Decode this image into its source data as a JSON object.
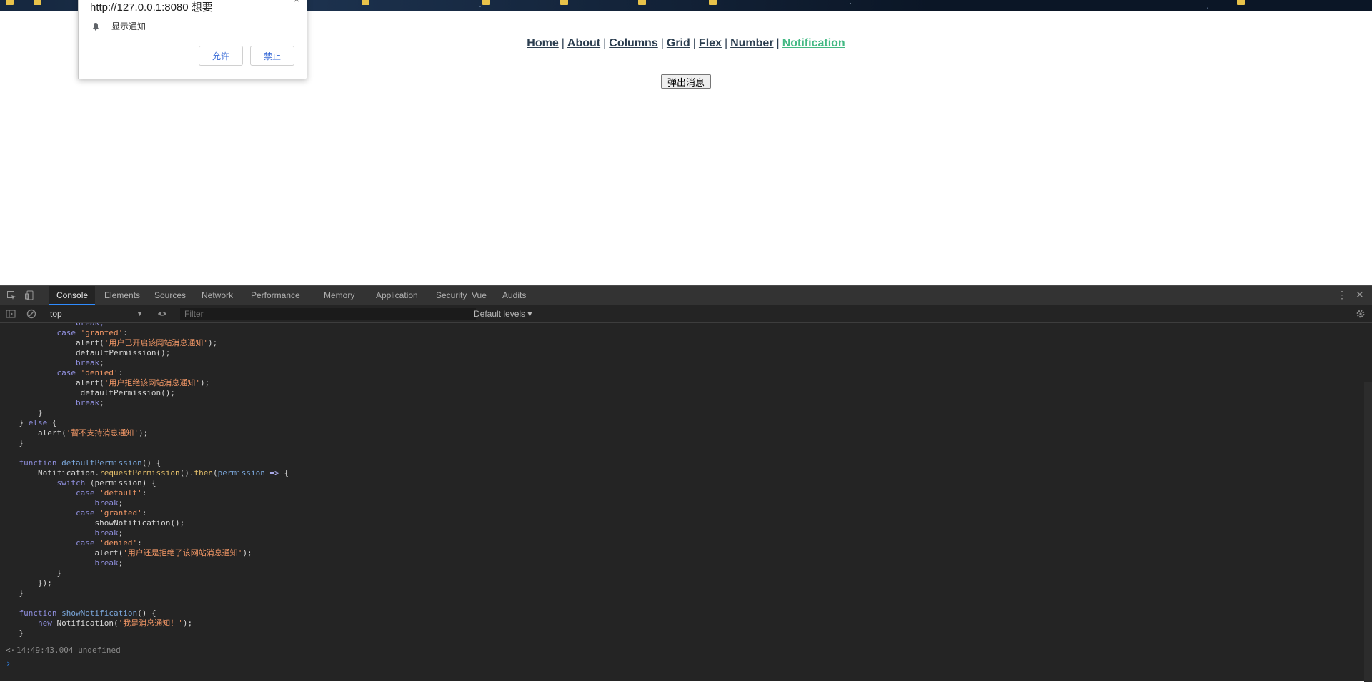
{
  "nav": {
    "links": [
      "Home",
      "About",
      "Columns",
      "Grid",
      "Flex",
      "Number",
      "Notification"
    ],
    "separator": "|",
    "active": "Notification",
    "active_color": "#42b983"
  },
  "popup_button_label": "弹出消息",
  "permission_dialog": {
    "origin": "http://127.0.0.1:8080 想要",
    "request": "显示通知",
    "allow": "允许",
    "block": "禁止"
  },
  "devtools": {
    "tabs": [
      "Console",
      "Elements",
      "Sources",
      "Network",
      "Performance",
      "Memory",
      "Application",
      "Security",
      "Vue",
      "Audits"
    ],
    "active_tab": "Console",
    "context": "top",
    "filter_placeholder": "Filter",
    "levels": "Default levels ▾",
    "result_time": "14:49:43.004",
    "result_value": "undefined",
    "code_lines": [
      [
        [
          "                break;",
          "kw"
        ]
      ],
      [
        [
          "            ",
          "plain"
        ],
        [
          "case",
          "kw"
        ],
        [
          " ",
          "plain"
        ],
        [
          "'granted'",
          "str"
        ],
        [
          ":",
          "plain"
        ]
      ],
      [
        [
          "                alert(",
          "plain"
        ],
        [
          "'用户已开启该网站消息通知'",
          "str"
        ],
        [
          ");",
          "plain"
        ]
      ],
      [
        [
          "                defaultPermission();",
          "plain"
        ]
      ],
      [
        [
          "                ",
          "plain"
        ],
        [
          "break",
          "kw"
        ],
        [
          ";",
          "plain"
        ]
      ],
      [
        [
          "            ",
          "plain"
        ],
        [
          "case",
          "kw"
        ],
        [
          " ",
          "plain"
        ],
        [
          "'denied'",
          "str"
        ],
        [
          ":",
          "plain"
        ]
      ],
      [
        [
          "                alert(",
          "plain"
        ],
        [
          "'用户拒绝该网站消息通知'",
          "str"
        ],
        [
          ");",
          "plain"
        ]
      ],
      [
        [
          "                 defaultPermission();",
          "plain"
        ]
      ],
      [
        [
          "                ",
          "plain"
        ],
        [
          "break",
          "kw"
        ],
        [
          ";",
          "plain"
        ]
      ],
      [
        [
          "        }",
          "plain"
        ]
      ],
      [
        [
          "    } ",
          "plain"
        ],
        [
          "else",
          "kw"
        ],
        [
          " {",
          "plain"
        ]
      ],
      [
        [
          "        alert(",
          "plain"
        ],
        [
          "'暂不支持消息通知'",
          "str"
        ],
        [
          ");",
          "plain"
        ]
      ],
      [
        [
          "    }",
          "plain"
        ]
      ],
      [
        [
          "",
          "plain"
        ]
      ],
      [
        [
          "    ",
          "plain"
        ],
        [
          "function",
          "kw"
        ],
        [
          " ",
          "plain"
        ],
        [
          "defaultPermission",
          "fn"
        ],
        [
          "() {",
          "plain"
        ]
      ],
      [
        [
          "        Notification.",
          "plain"
        ],
        [
          "requestPermission",
          "mth"
        ],
        [
          "().",
          "plain"
        ],
        [
          "then",
          "mth"
        ],
        [
          "(",
          "plain"
        ],
        [
          "permission",
          "fn"
        ],
        [
          " ",
          "plain"
        ],
        [
          "=>",
          "op"
        ],
        [
          " {",
          "plain"
        ]
      ],
      [
        [
          "            ",
          "plain"
        ],
        [
          "switch",
          "kw"
        ],
        [
          " (permission) {",
          "plain"
        ]
      ],
      [
        [
          "                ",
          "plain"
        ],
        [
          "case",
          "kw"
        ],
        [
          " ",
          "plain"
        ],
        [
          "'default'",
          "str"
        ],
        [
          ":",
          "plain"
        ]
      ],
      [
        [
          "                    ",
          "plain"
        ],
        [
          "break",
          "kw"
        ],
        [
          ";",
          "plain"
        ]
      ],
      [
        [
          "                ",
          "plain"
        ],
        [
          "case",
          "kw"
        ],
        [
          " ",
          "plain"
        ],
        [
          "'granted'",
          "str"
        ],
        [
          ":",
          "plain"
        ]
      ],
      [
        [
          "                    showNotification();",
          "plain"
        ]
      ],
      [
        [
          "                    ",
          "plain"
        ],
        [
          "break",
          "kw"
        ],
        [
          ";",
          "plain"
        ]
      ],
      [
        [
          "                ",
          "plain"
        ],
        [
          "case",
          "kw"
        ],
        [
          " ",
          "plain"
        ],
        [
          "'denied'",
          "str"
        ],
        [
          ":",
          "plain"
        ]
      ],
      [
        [
          "                    alert(",
          "plain"
        ],
        [
          "'用户还是拒绝了该网站消息通知'",
          "str"
        ],
        [
          ");",
          "plain"
        ]
      ],
      [
        [
          "                    ",
          "plain"
        ],
        [
          "break",
          "kw"
        ],
        [
          ";",
          "plain"
        ]
      ],
      [
        [
          "            }",
          "plain"
        ]
      ],
      [
        [
          "        });",
          "plain"
        ]
      ],
      [
        [
          "    }",
          "plain"
        ]
      ],
      [
        [
          "",
          "plain"
        ]
      ],
      [
        [
          "    ",
          "plain"
        ],
        [
          "function",
          "kw"
        ],
        [
          " ",
          "plain"
        ],
        [
          "showNotification",
          "fn"
        ],
        [
          "() {",
          "plain"
        ]
      ],
      [
        [
          "        ",
          "plain"
        ],
        [
          "new",
          "kw"
        ],
        [
          " Notification(",
          "plain"
        ],
        [
          "'我是消息通知！'",
          "str"
        ],
        [
          ");",
          "plain"
        ]
      ],
      [
        [
          "    }",
          "plain"
        ]
      ]
    ]
  }
}
